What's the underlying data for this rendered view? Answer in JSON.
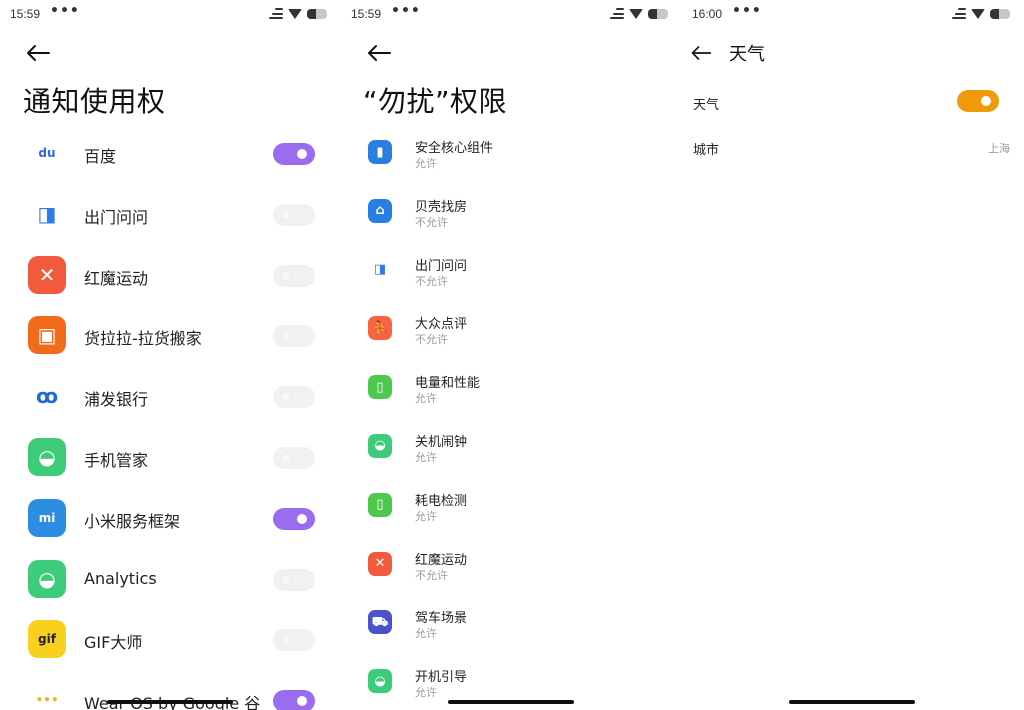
{
  "screen1": {
    "status": {
      "time": "15:59",
      "dots": "•••"
    },
    "title": "通知使用权",
    "apps": [
      {
        "name": "百度",
        "enabled": true,
        "icon": "baidu-icon",
        "icon_bg": "#ffffff",
        "icon_fg": "#2f66e9",
        "glyph": "du"
      },
      {
        "name": "出门问问",
        "enabled": false,
        "icon": "mobvoi-icon",
        "icon_bg": "#ffffff",
        "icon_fg": "#2f7be9",
        "glyph": "◨"
      },
      {
        "name": "红魔运动",
        "enabled": false,
        "icon": "redmagic-sport-icon",
        "icon_bg": "#f15a3c",
        "icon_fg": "#ffffff",
        "glyph": "✕"
      },
      {
        "name": "货拉拉-拉货搬家",
        "enabled": false,
        "icon": "lalamove-icon",
        "icon_bg": "#f26b1d",
        "icon_fg": "#ffffff",
        "glyph": "▣"
      },
      {
        "name": "浦发银行",
        "enabled": false,
        "icon": "spdb-icon",
        "icon_bg": "#ffffff",
        "icon_fg": "#1e6cd6",
        "glyph": "ꝏ"
      },
      {
        "name": "手机管家",
        "enabled": false,
        "icon": "android-icon",
        "icon_bg": "#3dcd7a",
        "icon_fg": "#ffffff",
        "glyph": "◒"
      },
      {
        "name": "小米服务框架",
        "enabled": true,
        "icon": "mi-service-icon",
        "icon_bg": "#2b8ee0",
        "icon_fg": "#ffffff",
        "glyph": "mi"
      },
      {
        "name": "Analytics",
        "enabled": false,
        "icon": "android-icon",
        "icon_bg": "#3dcd7a",
        "icon_fg": "#ffffff",
        "glyph": "◒"
      },
      {
        "name": "GIF大师",
        "enabled": false,
        "icon": "gif-master-icon",
        "icon_bg": "#f7d020",
        "icon_fg": "#222222",
        "glyph": "gif"
      },
      {
        "name": "Wear OS by Google 谷",
        "enabled": true,
        "icon": "wearos-icon",
        "icon_bg": "#ffffff",
        "icon_fg": "#f2b233",
        "glyph": "•••"
      }
    ]
  },
  "screen2": {
    "status": {
      "time": "15:59",
      "dots": "•••"
    },
    "title": "“勿扰”权限",
    "apps": [
      {
        "name": "安全核心组件",
        "perm": "允许",
        "icon": "security-core-icon",
        "icon_bg": "#2a7de1",
        "glyph": "▮"
      },
      {
        "name": "贝壳找房",
        "perm": "不允许",
        "icon": "beike-icon",
        "icon_bg": "#2a7de1",
        "glyph": "⌂"
      },
      {
        "name": "出门问问",
        "perm": "不允许",
        "icon": "mobvoi-icon",
        "icon_bg": "#ffffff",
        "glyph": "◨"
      },
      {
        "name": "大众点评",
        "perm": "不允许",
        "icon": "dianping-icon",
        "icon_bg": "#f6653f",
        "glyph": "⛹"
      },
      {
        "name": "电量和性能",
        "perm": "允许",
        "icon": "battery-icon",
        "icon_bg": "#4ec94e",
        "glyph": "▯"
      },
      {
        "name": "关机闹钟",
        "perm": "允许",
        "icon": "android-icon",
        "icon_bg": "#3dcd7a",
        "glyph": "◒"
      },
      {
        "name": "耗电检测",
        "perm": "允许",
        "icon": "battery-icon",
        "icon_bg": "#4ec94e",
        "glyph": "▯"
      },
      {
        "name": "红魔运动",
        "perm": "不允许",
        "icon": "redmagic-sport-icon",
        "icon_bg": "#f15a3c",
        "glyph": "✕"
      },
      {
        "name": "驾车场景",
        "perm": "允许",
        "icon": "car-icon",
        "icon_bg": "#4d52c8",
        "glyph": "⛟"
      },
      {
        "name": "开机引导",
        "perm": "允许",
        "icon": "android-icon",
        "icon_bg": "#3dcd7a",
        "glyph": "◒"
      }
    ]
  },
  "screen3": {
    "status": {
      "time": "16:00",
      "dots": "•••"
    },
    "title": "天气",
    "weather_label": "天气",
    "weather_enabled": true,
    "city_label": "城市",
    "city_value": "上海"
  },
  "colors": {
    "toggle_on_purple": "#9a6cf0",
    "toggle_on_orange": "#ef9a0b",
    "toggle_off": "#f1f1f1"
  }
}
